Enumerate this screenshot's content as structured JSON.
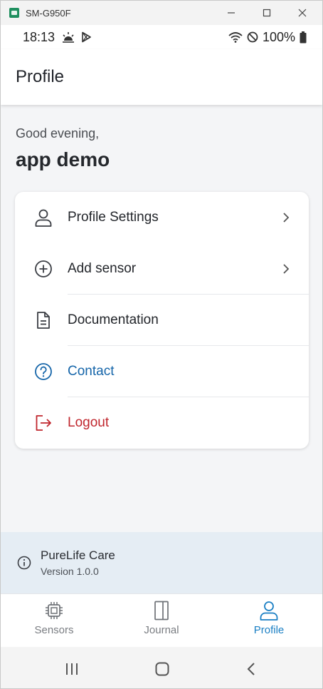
{
  "window": {
    "title": "SM-G950F",
    "controls": [
      "minimize-icon",
      "maximize-icon",
      "close-icon"
    ]
  },
  "statusbar": {
    "time": "18:13",
    "left_icons": [
      "weather-icon",
      "play-store-icon"
    ],
    "right_icons": [
      "wifi-icon",
      "do-not-disturb-icon",
      "battery-icon"
    ],
    "battery": "100%"
  },
  "header": {
    "title": "Profile"
  },
  "greeting": {
    "salutation": "Good evening,",
    "name": "app demo"
  },
  "menu": {
    "items": [
      {
        "label": "Profile Settings",
        "icon": "user-icon",
        "chevron": true,
        "color": "#23262b"
      },
      {
        "label": "Add sensor",
        "icon": "plus-circle-icon",
        "chevron": true,
        "color": "#23262b"
      },
      {
        "label": "Documentation",
        "icon": "document-icon",
        "chevron": false,
        "color": "#23262b"
      },
      {
        "label": "Contact",
        "icon": "help-circle-icon",
        "chevron": false,
        "color": "#1565a9"
      },
      {
        "label": "Logout",
        "icon": "logout-icon",
        "chevron": false,
        "color": "#c0262d"
      }
    ]
  },
  "app_info": {
    "name": "PureLife Care",
    "version": "Version 1.0.0",
    "icon": "info-icon"
  },
  "bottom_nav": {
    "items": [
      {
        "label": "Sensors",
        "icon": "chip-icon",
        "active": false
      },
      {
        "label": "Journal",
        "icon": "book-icon",
        "active": false
      },
      {
        "label": "Profile",
        "icon": "user-icon",
        "active": true
      }
    ],
    "active_color": "#1a7fc4"
  },
  "system_nav": [
    "recent-apps-icon",
    "home-icon",
    "back-icon"
  ]
}
